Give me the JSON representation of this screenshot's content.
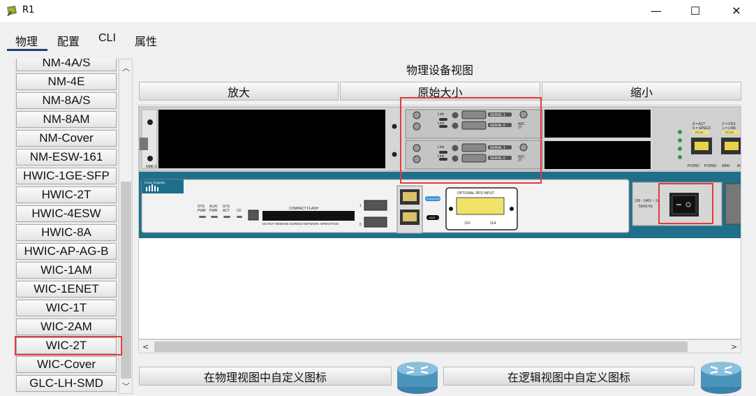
{
  "window": {
    "title": "R1",
    "minimize": "—",
    "maximize": "☐",
    "close": "✕"
  },
  "tabs": [
    {
      "label": "物理"
    },
    {
      "label": "配置"
    },
    {
      "label": "CLI"
    },
    {
      "label": "属性"
    }
  ],
  "modules": [
    "NM-4A/S",
    "NM-4E",
    "NM-8A/S",
    "NM-8AM",
    "NM-Cover",
    "NM-ESW-161",
    "HWIC-1GE-SFP",
    "HWIC-2T",
    "HWIC-4ESW",
    "HWIC-8A",
    "HWIC-AP-AG-B",
    "WIC-1AM",
    "WIC-1ENET",
    "WIC-1T",
    "WIC-2AM",
    "WIC-2T",
    "WIC-Cover",
    "GLC-LH-SMD"
  ],
  "selected_module": "WIC-2T",
  "view": {
    "title": "物理设备视图",
    "zoom_in": "放大",
    "original_size": "原始大小",
    "zoom_out": "缩小"
  },
  "bottom": {
    "custom_physical_icon": "在物理视图中自定义图标",
    "custom_logical_icon": "在逻辑视图中自定义图标"
  },
  "device": {
    "slot_label_0": "NME 0",
    "slot_labels": [
      "SLOT 1",
      "SLOT 0"
    ],
    "serial_labels": [
      "SERIAL 1",
      "SERIAL 0"
    ],
    "link_label": "Link",
    "wic_label": "WIC 2T",
    "brand": "Cisco Systems",
    "status_leds": [
      "SYS PWR",
      "AUX/ PWR",
      "SYS ACT",
      "CF"
    ],
    "compact_flash": "COMPACT FLASH",
    "cf_warning": "DO NOT REMOVE DURING NETWORK OPERATION",
    "console": "CONSOLE",
    "aux": "AUX",
    "rps": "OPTIONAL RPS INPUT",
    "rps_volt": "12V",
    "rps_amp": "11A",
    "power_spec": "100 - 240V ~ 2A 50/60 Hz",
    "fe_labels": [
      "A = ACT S = SPEED",
      "F = FDX L = LINK"
    ],
    "fe_ports": [
      "FE 0/1",
      "FE 0/0"
    ],
    "pvdm_labels": [
      "PVDM1",
      "PVDM2",
      "AIM1",
      "AIM0"
    ],
    "usb_ports": [
      "1",
      "0"
    ]
  },
  "colors": {
    "router_teal": "#1f6f8b",
    "highlight_red": "#e23b3b"
  }
}
